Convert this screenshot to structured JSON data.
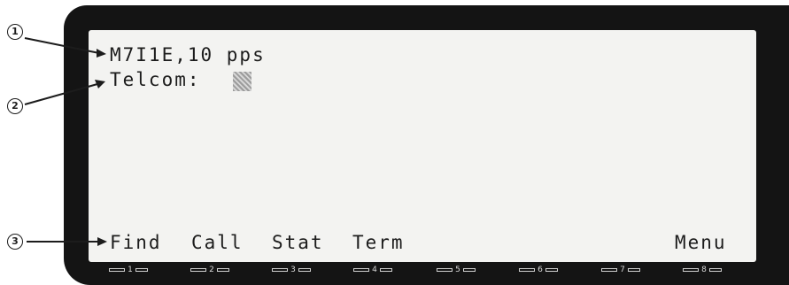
{
  "display": {
    "line1": "M7I1E,10 pps",
    "line2_label": "Telcom:"
  },
  "softkeys": [
    "Find",
    "Call",
    "Stat",
    "Term",
    "Menu"
  ],
  "callouts": [
    "1",
    "2",
    "3"
  ],
  "keypad": [
    "1",
    "2",
    "3",
    "4",
    "5",
    "6",
    "7",
    "8"
  ]
}
